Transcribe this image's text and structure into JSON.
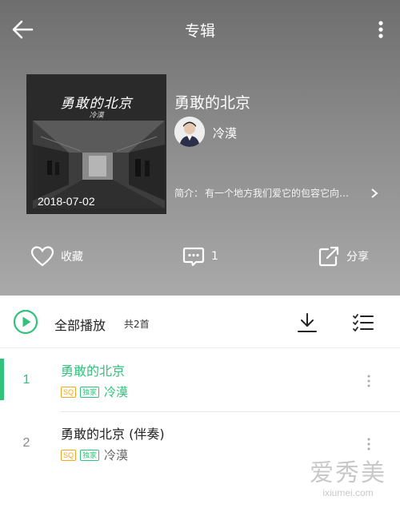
{
  "header": {
    "title": "专辑"
  },
  "album": {
    "cover_title": "勇敢的北京",
    "cover_artist": "冷漠",
    "release_date": "2018-07-02",
    "title": "勇敢的北京",
    "artist": "冷漠",
    "intro_label": "简介：",
    "intro_text": "有一个地方我们爱它的包容它向…"
  },
  "actions": {
    "favorite_label": "收藏",
    "comment_count": "1",
    "share_label": "分享"
  },
  "playbar": {
    "play_all_label": "全部播放",
    "count_label": "共2首"
  },
  "songs": [
    {
      "index": "1",
      "title": "勇敢的北京",
      "artist": "冷漠",
      "tags": [
        "SQ",
        "独家"
      ],
      "active": true
    },
    {
      "index": "2",
      "title": "勇敢的北京 (伴奏)",
      "artist": "冷漠",
      "tags": [
        "SQ",
        "独家"
      ],
      "active": false
    }
  ],
  "watermark": {
    "main": "爱秀美",
    "sub": "ixiumei.com"
  },
  "colors": {
    "accent": "#31c27c",
    "sq_tag": "#f5a623",
    "header_gradient_top": "#6e6e6e",
    "header_gradient_bottom": "#a9a9a9"
  }
}
